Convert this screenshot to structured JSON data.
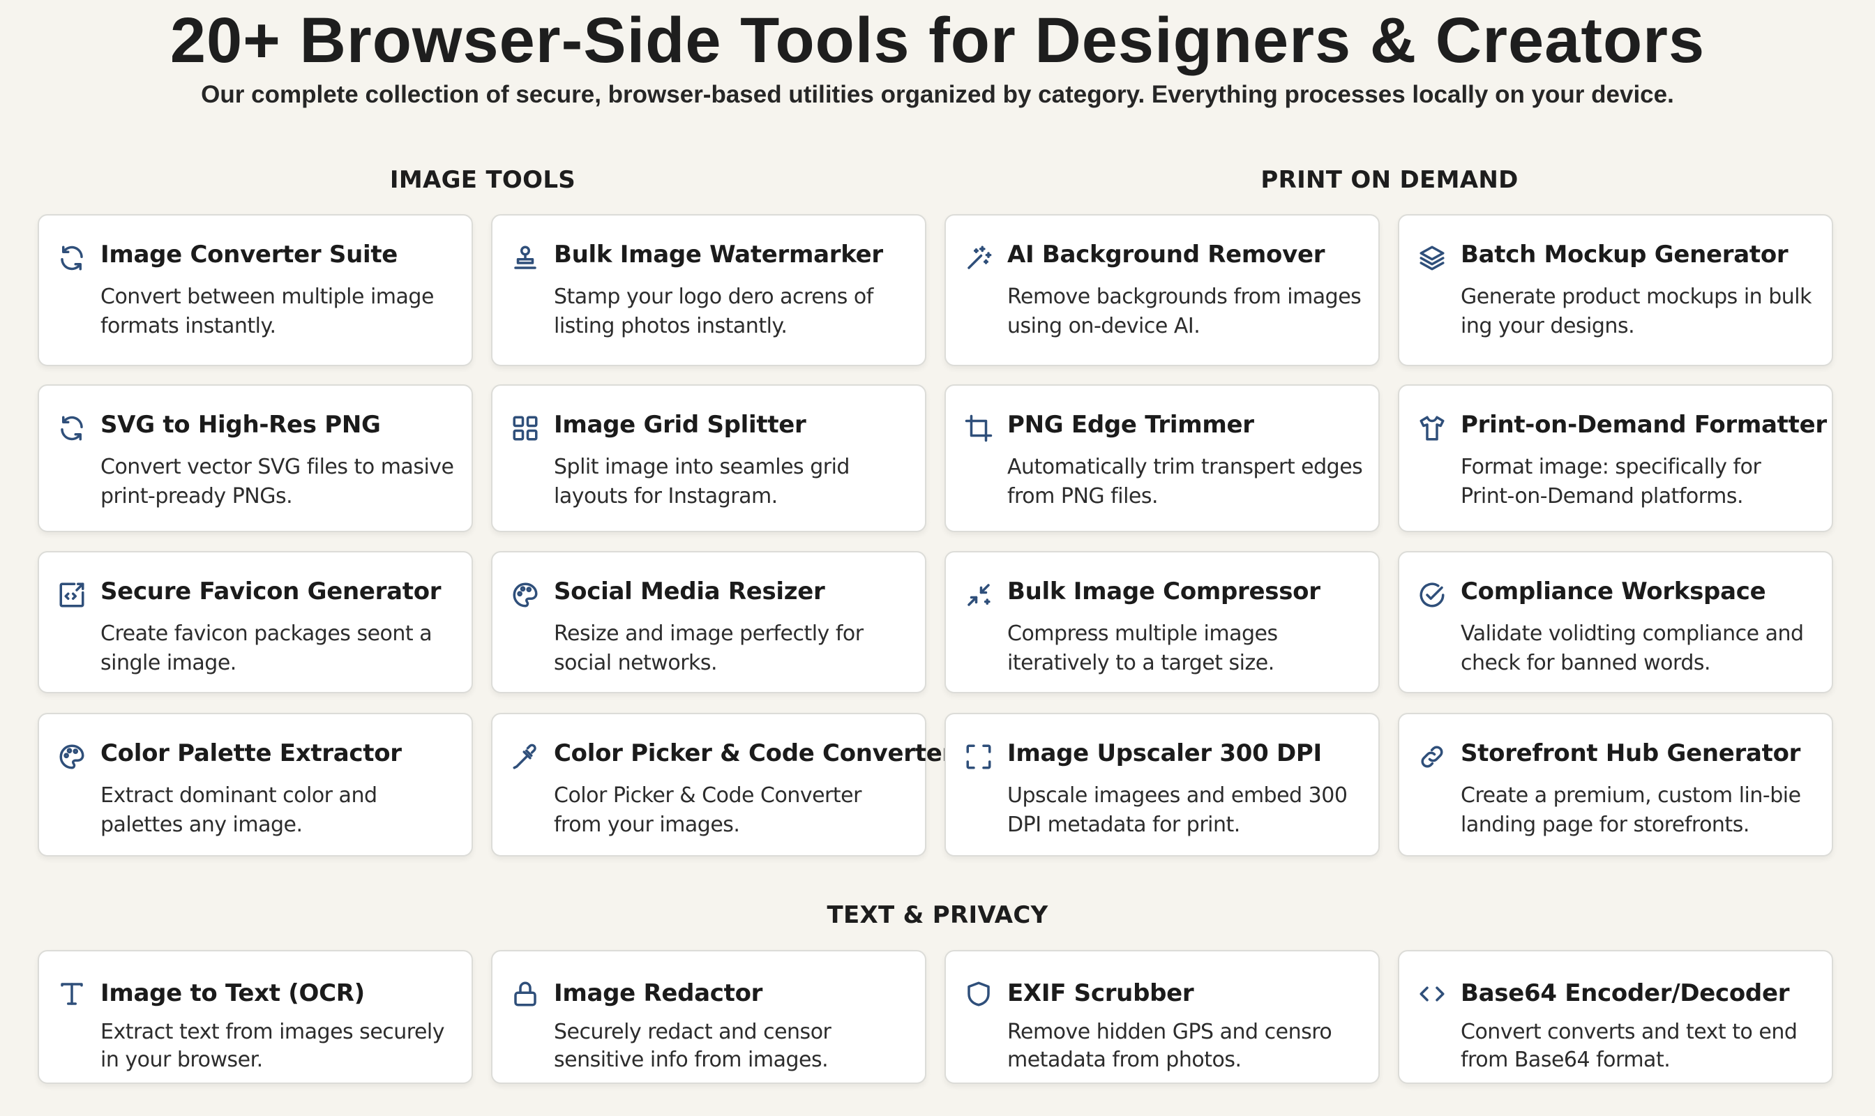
{
  "header": {
    "title": "20+ Browser-Side Tools for Designers & Creators",
    "subtitle": "Our complete collection of secure, browser-based utilities organized by category. Everything processes locally on your device."
  },
  "sections": {
    "image_tools": "IMAGE TOOLS",
    "print_on_demand": "PRINT ON DEMAND",
    "text_privacy": "TEXT & PRIVACY"
  },
  "accent_color": "#2f4f7a",
  "tools": [
    {
      "title": "Image Converter Suite",
      "desc": "Convert between multiple image formats instantly.",
      "icon": "refresh-icon"
    },
    {
      "title": "Bulk Image Watermarker",
      "desc": "Stamp your logo dero acrens of listing photos instantly.",
      "icon": "stamp-icon"
    },
    {
      "title": "AI Background Remover",
      "desc": "Remove backgrounds from images using on-device AI.",
      "icon": "magic-wand-icon"
    },
    {
      "title": "Batch Mockup Generator",
      "desc": "Generate product mockups in bulk ing your designs.",
      "icon": "layers-icon"
    },
    {
      "title": "SVG to High-Res PNG",
      "desc": "Convert vector SVG files to masive print-pready PNGs.",
      "icon": "refresh-icon"
    },
    {
      "title": "Image Grid Splitter",
      "desc": "Split image into seamles grid layouts for Instagram.",
      "icon": "grid-icon"
    },
    {
      "title": "PNG Edge Trimmer",
      "desc": "Automatically trim transpert edges from PNG files.",
      "icon": "crop-icon"
    },
    {
      "title": "Print-on-Demand Formatter",
      "desc": "Format image: specifically for Print-on-Demand platforms.",
      "icon": "tshirt-icon"
    },
    {
      "title": "Secure Favicon Generator",
      "desc": "Create favicon packages seont a single image.",
      "icon": "code-frame-icon"
    },
    {
      "title": "Social Media Resizer",
      "desc": "Resize and image perfectly for social networks.",
      "icon": "palette-icon"
    },
    {
      "title": "Bulk Image Compressor",
      "desc": "Compress multiple images iteratively to a target size.",
      "icon": "compress-arrows-icon"
    },
    {
      "title": "Compliance Workspace",
      "desc": "Validate volidting compliance and check for banned words.",
      "icon": "check-circle-icon"
    },
    {
      "title": "Color Palette Extractor",
      "desc": "Extract dominant color and palettes any image.",
      "icon": "palette-icon"
    },
    {
      "title": "Color Picker & Code Converter",
      "desc": "Color Picker & Code Converter from your images.",
      "icon": "eyedropper-icon"
    },
    {
      "title": "Image Upscaler 300 DPI",
      "desc": "Upscale imagees and embed 300 DPI metadata for print.",
      "icon": "expand-icon"
    },
    {
      "title": "Storefront Hub Generator",
      "desc": "Create a premium, custom lin-bie landing page for storefronts.",
      "icon": "link-icon"
    },
    {
      "title": "Image to Text (OCR)",
      "desc": "Extract text from images securely in your browser.",
      "icon": "text-icon"
    },
    {
      "title": "Image Redactor",
      "desc": "Securely redact and censor sensitive info from images.",
      "icon": "lock-icon"
    },
    {
      "title": "EXIF Scrubber",
      "desc": "Remove hidden GPS and censro metadata from photos.",
      "icon": "shield-icon"
    },
    {
      "title": "Base64 Encoder/Decoder",
      "desc": "Convert converts and text to end from Base64 format.",
      "icon": "code-icon"
    }
  ]
}
